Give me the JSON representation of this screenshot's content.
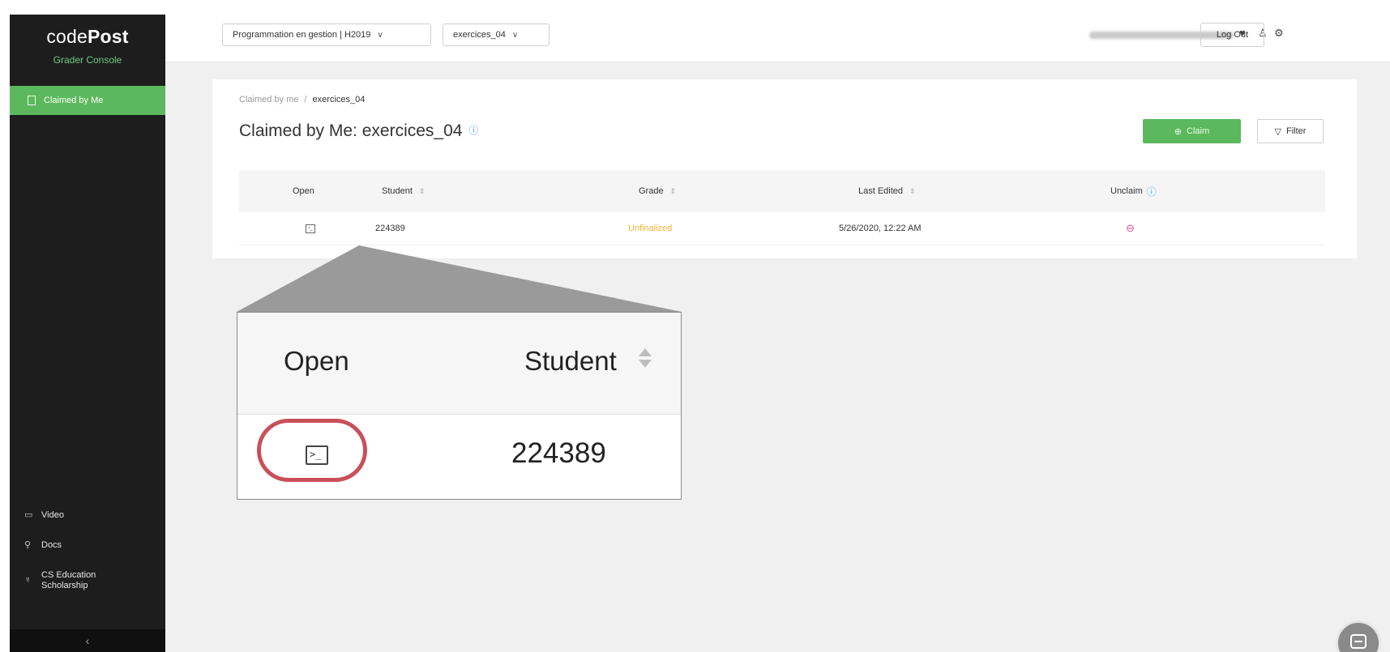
{
  "sidebar": {
    "logo_light": "code",
    "logo_bold": "Post",
    "subtitle": "Grader Console",
    "active_item": "Claimed by Me",
    "links": [
      {
        "icon": "video-icon",
        "glyph": "▭",
        "label": "Video"
      },
      {
        "icon": "docs-icon",
        "glyph": "⚲",
        "label": "Docs"
      },
      {
        "icon": "trophy-icon",
        "glyph": "♆",
        "label": "CS Education Scholarship"
      }
    ],
    "collapse_glyph": "‹"
  },
  "topbar": {
    "course_select": "Programmation en gestion | H2019",
    "assignment_select": "exercices_04",
    "logout_label": "Log Out",
    "icons": [
      "heart-icon",
      "user-icon",
      "gear-icon"
    ]
  },
  "main": {
    "breadcrumb_root": "Claimed by me",
    "breadcrumb_sep": "/",
    "breadcrumb_current": "exercices_04",
    "title": "Claimed by Me: exercices_04",
    "claim_label": "Claim",
    "filter_label": "Filter",
    "columns": [
      "Open",
      "Student",
      "Grade",
      "Last Edited",
      "Unclaim"
    ],
    "rows": [
      {
        "student": "224389",
        "grade": "Unfinalized",
        "last_edited": "5/26/2020, 12:22 AM"
      }
    ]
  },
  "zoom": {
    "open_label": "Open",
    "student_label": "Student",
    "student_id": "224389"
  },
  "colors": {
    "accent_green": "#5cb85c",
    "sidebar_bg": "#1d1d1d",
    "unfinalized": "#f0b43c",
    "unclaim": "#e0559a",
    "highlight_ring": "#c8505a",
    "info_blue": "#3ba3ee"
  }
}
